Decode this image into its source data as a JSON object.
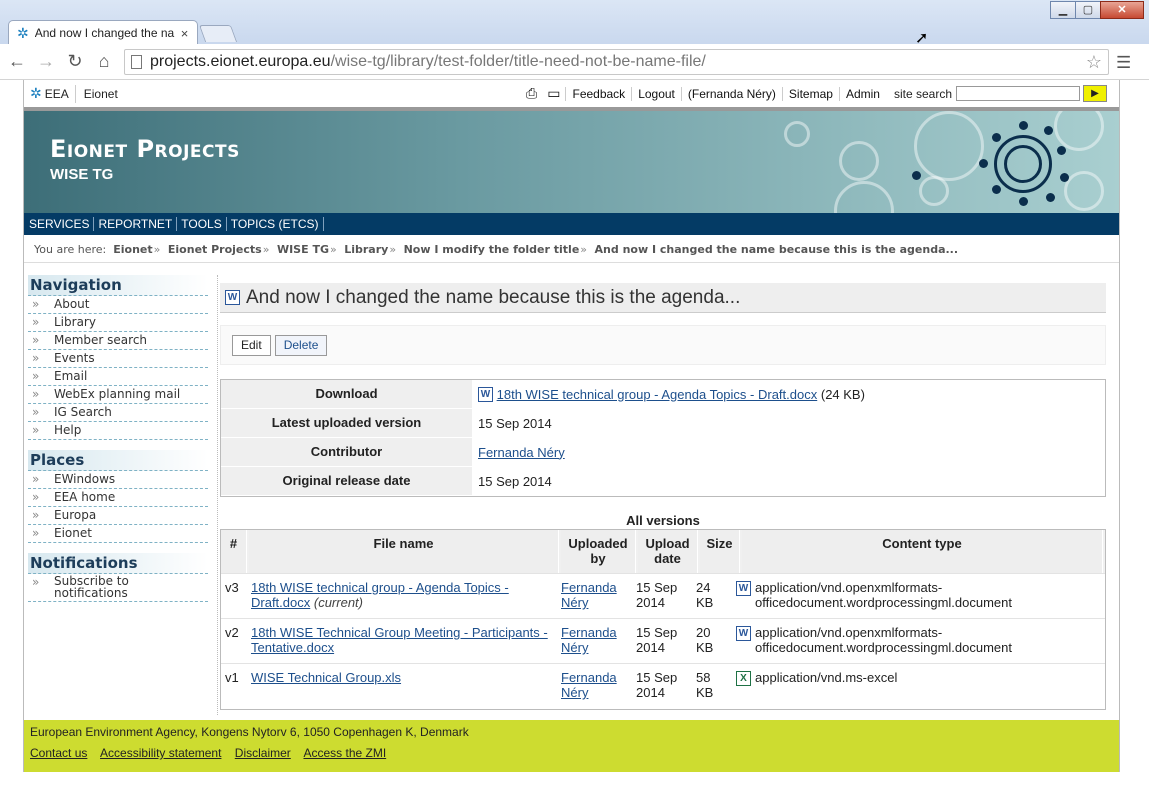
{
  "browser": {
    "tab_title": "And now I changed the na",
    "tab_close": "×",
    "url_host": "projects.eionet.europa.eu",
    "url_path": "/wise-tg/library/test-folder/title-need-not-be-name-file/",
    "window_buttons": [
      "▁",
      "▢",
      "✕"
    ]
  },
  "topbar": {
    "eea": "EEA",
    "eionet": "Eionet",
    "links": [
      "Feedback",
      "Logout",
      "(Fernanda Néry)",
      "Sitemap",
      "Admin"
    ],
    "search_label": "site search",
    "search_go": "▶"
  },
  "banner": {
    "title": "Eionet Projects",
    "subtitle": "WISE TG"
  },
  "mainmenu": [
    "SERVICES",
    "REPORTNET",
    "TOOLS",
    "TOPICS (ETCS)"
  ],
  "breadcrumb": {
    "prefix": "You are here:",
    "items": [
      "Eionet",
      "Eionet Projects",
      "WISE TG",
      "Library",
      "Now I modify the folder title",
      "And now I changed the name because this is the agenda..."
    ]
  },
  "sidebar": {
    "navigation": {
      "title": "Navigation",
      "items": [
        "About",
        "Library",
        "Member search",
        "Events",
        "Email",
        "WebEx planning mail",
        "IG Search",
        "Help"
      ]
    },
    "places": {
      "title": "Places",
      "items": [
        "EWindows",
        "EEA home",
        "Europa",
        "Eionet"
      ]
    },
    "notifications": {
      "title": "Notifications",
      "items": [
        "Subscribe to notifications"
      ]
    }
  },
  "content": {
    "title": "And now I changed the name because this is the agenda...",
    "edit_label": "Edit",
    "delete_label": "Delete",
    "props": {
      "download_label": "Download",
      "download_file": "18th WISE technical group - Agenda Topics - Draft.docx",
      "download_size": "(24 KB)",
      "latest_label": "Latest uploaded version",
      "latest_value": "15 Sep 2014",
      "contributor_label": "Contributor",
      "contributor_value": "Fernanda Néry",
      "release_label": "Original release date",
      "release_value": "15 Sep 2014"
    },
    "versions": {
      "title": "All versions",
      "headers": [
        "#",
        "File name",
        "Uploaded by",
        "Upload date",
        "Size",
        "Content type"
      ],
      "rows": [
        {
          "num": "v3",
          "file": "18th WISE technical group - Agenda Topics - Draft.docx",
          "current": "(current)",
          "by": "Fernanda Néry",
          "date": "15 Sep 2014",
          "size": "24 KB",
          "type": "application/vnd.openxmlformats-officedocument.wordprocessingml.document",
          "icon": "word-icon"
        },
        {
          "num": "v2",
          "file": "18th WISE Technical Group Meeting - Participants - Tentative.docx",
          "current": "",
          "by": "Fernanda Néry",
          "date": "15 Sep 2014",
          "size": "20 KB",
          "type": "application/vnd.openxmlformats-officedocument.wordprocessingml.document",
          "icon": "word-icon"
        },
        {
          "num": "v1",
          "file": "WISE Technical Group.xls",
          "current": "",
          "by": "Fernanda Néry",
          "date": "15 Sep 2014",
          "size": "58 KB",
          "type": "application/vnd.ms-excel",
          "icon": "excel-icon"
        }
      ]
    }
  },
  "footer": {
    "address": "European Environment Agency, Kongens Nytorv 6, 1050 Copenhagen K, Denmark",
    "links": [
      "Contact us",
      "Accessibility statement",
      "Disclaimer",
      "Access the ZMI"
    ]
  }
}
